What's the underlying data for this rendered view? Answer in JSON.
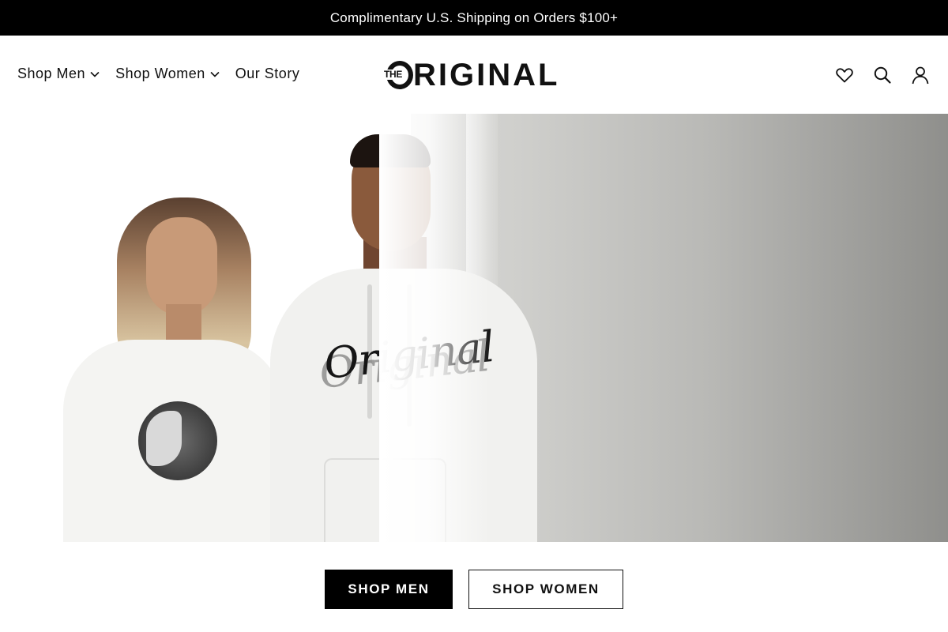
{
  "announcement": {
    "text": "Complimentary U.S. Shipping on Orders $100+"
  },
  "nav": {
    "items": [
      {
        "label": "Shop Men",
        "has_dropdown": true
      },
      {
        "label": "Shop Women",
        "has_dropdown": true
      },
      {
        "label": "Our Story",
        "has_dropdown": false
      }
    ]
  },
  "logo": {
    "prefix": "THE",
    "main": "RIGINAL"
  },
  "header_icons": [
    "heart-icon",
    "search-icon",
    "account-icon"
  ],
  "hero": {
    "image": "two models in white sweatshirts",
    "shirt_text": "Original"
  },
  "cta": {
    "primary_label": "SHOP MEN",
    "secondary_label": "SHOP WOMEN"
  },
  "colors": {
    "bar_bg": "#000000",
    "text": "#111111",
    "page_bg": "#ffffff"
  }
}
